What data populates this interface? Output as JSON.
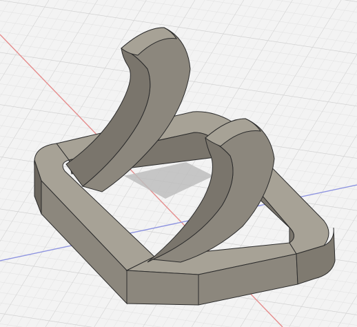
{
  "viewport": {
    "background": "#f3f3f3",
    "grid_minor_color": "#e2e2e2",
    "grid_major_color": "#cfcfcf",
    "x_axis_color": "#e58c8c",
    "y_axis_color": "#8d93e0"
  },
  "model": {
    "body_color": "#8c877d",
    "body_light": "#a7a296",
    "body_dark": "#6c675f",
    "edge_color": "#2b2b2b",
    "shadow_color": "#bdbdbd"
  },
  "icons": {
    "model_icon": "bent-frame-3d-model"
  }
}
